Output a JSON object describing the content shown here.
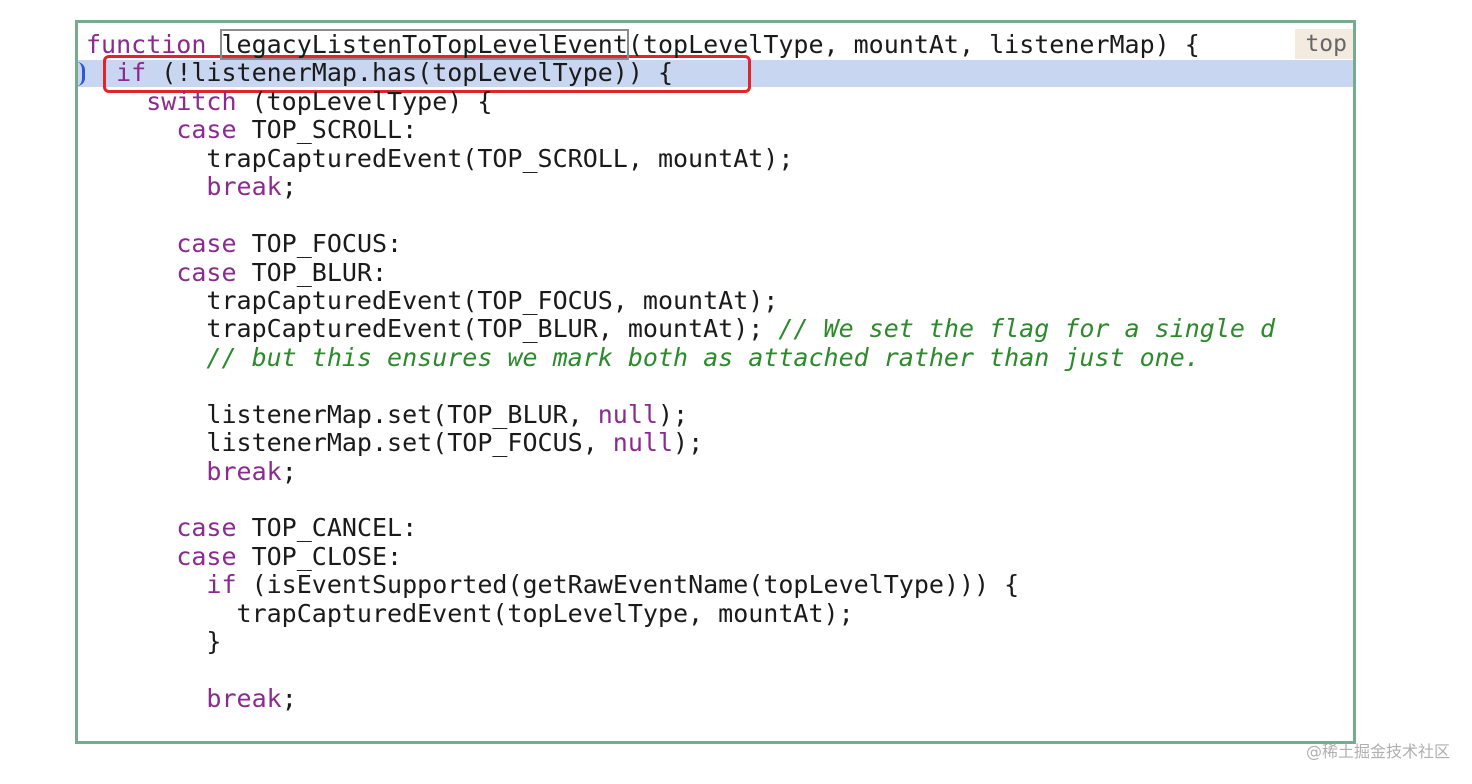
{
  "editor": {
    "inline_hint": "top",
    "lines": [
      [
        {
          "t": "function ",
          "c": "kw"
        },
        {
          "t": "legacyListenToTopLevelEvent",
          "c": "fnbox"
        },
        {
          "t": "(topLevelType, mountAt, listenerMap) {",
          "c": ""
        }
      ],
      [
        {
          "t": "  ",
          "c": ""
        },
        {
          "t": "if",
          "c": "kw"
        },
        {
          "t": " (!listenerMap.has(topLevelType)) {",
          "c": ""
        }
      ],
      [
        {
          "t": "    ",
          "c": ""
        },
        {
          "t": "switch",
          "c": "kw"
        },
        {
          "t": " (topLevelType) {",
          "c": ""
        }
      ],
      [
        {
          "t": "      ",
          "c": ""
        },
        {
          "t": "case",
          "c": "kw"
        },
        {
          "t": " TOP_SCROLL:",
          "c": ""
        }
      ],
      [
        {
          "t": "        trapCapturedEvent(TOP_SCROLL, mountAt);",
          "c": ""
        }
      ],
      [
        {
          "t": "        ",
          "c": ""
        },
        {
          "t": "break",
          "c": "kw"
        },
        {
          "t": ";",
          "c": ""
        }
      ],
      [],
      [
        {
          "t": "      ",
          "c": ""
        },
        {
          "t": "case",
          "c": "kw"
        },
        {
          "t": " TOP_FOCUS:",
          "c": ""
        }
      ],
      [
        {
          "t": "      ",
          "c": ""
        },
        {
          "t": "case",
          "c": "kw"
        },
        {
          "t": " TOP_BLUR:",
          "c": ""
        }
      ],
      [
        {
          "t": "        trapCapturedEvent(TOP_FOCUS, mountAt);",
          "c": ""
        }
      ],
      [
        {
          "t": "        trapCapturedEvent(TOP_BLUR, mountAt); ",
          "c": ""
        },
        {
          "t": "// We set the flag for a single d",
          "c": "cm"
        }
      ],
      [
        {
          "t": "        ",
          "c": ""
        },
        {
          "t": "// but this ensures we mark both as attached rather than just one.",
          "c": "cm"
        }
      ],
      [],
      [
        {
          "t": "        listenerMap.set(TOP_BLUR, ",
          "c": ""
        },
        {
          "t": "null",
          "c": "kw"
        },
        {
          "t": ");",
          "c": ""
        }
      ],
      [
        {
          "t": "        listenerMap.set(TOP_FOCUS, ",
          "c": ""
        },
        {
          "t": "null",
          "c": "kw"
        },
        {
          "t": ");",
          "c": ""
        }
      ],
      [
        {
          "t": "        ",
          "c": ""
        },
        {
          "t": "break",
          "c": "kw"
        },
        {
          "t": ";",
          "c": ""
        }
      ],
      [],
      [
        {
          "t": "      ",
          "c": ""
        },
        {
          "t": "case",
          "c": "kw"
        },
        {
          "t": " TOP_CANCEL:",
          "c": ""
        }
      ],
      [
        {
          "t": "      ",
          "c": ""
        },
        {
          "t": "case",
          "c": "kw"
        },
        {
          "t": " TOP_CLOSE:",
          "c": ""
        }
      ],
      [
        {
          "t": "        ",
          "c": ""
        },
        {
          "t": "if",
          "c": "kw"
        },
        {
          "t": " (isEventSupported(getRawEventName(topLevelType))) {",
          "c": ""
        }
      ],
      [
        {
          "t": "          trapCapturedEvent(topLevelType, mountAt);",
          "c": ""
        }
      ],
      [
        {
          "t": "        }",
          "c": ""
        }
      ],
      [],
      [
        {
          "t": "        ",
          "c": ""
        },
        {
          "t": "break",
          "c": "kw"
        },
        {
          "t": ";",
          "c": ""
        }
      ]
    ]
  },
  "watermark": "@稀土掘金技术社区",
  "colors": {
    "keyword": "#8b2a8f",
    "comment": "#2b8a2b",
    "frame": "#76ab8e",
    "highlight": "#c9d6f2",
    "annotation": "#e0242a"
  }
}
